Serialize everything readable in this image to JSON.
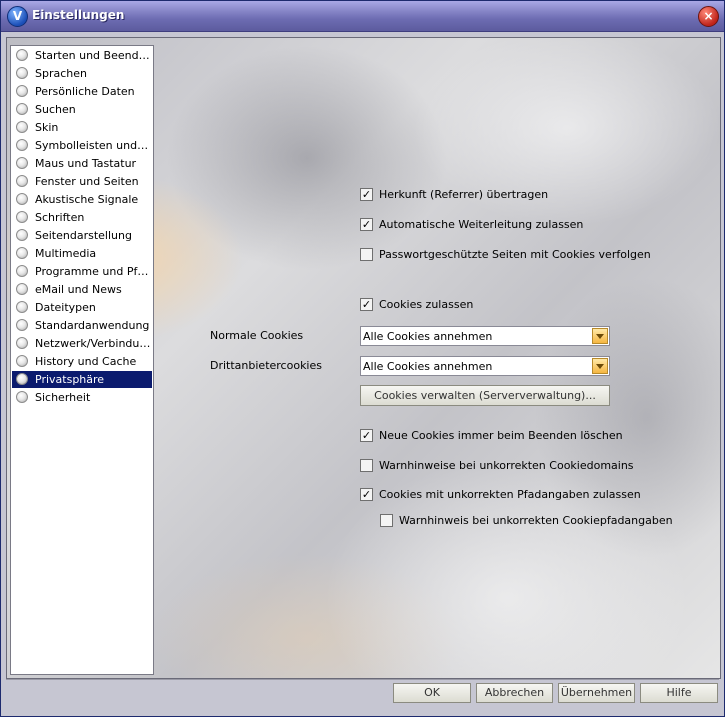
{
  "window": {
    "title": "Einstellungen",
    "icon": "app-logo-icon",
    "close": "close-icon"
  },
  "sidebar": {
    "items": [
      {
        "label": "Starten und Beenden"
      },
      {
        "label": "Sprachen"
      },
      {
        "label": "Persönliche Daten"
      },
      {
        "label": "Suchen"
      },
      {
        "label": "Skin"
      },
      {
        "label": "Symbolleisten und Me..."
      },
      {
        "label": "Maus und Tastatur"
      },
      {
        "label": "Fenster und Seiten"
      },
      {
        "label": "Akustische Signale"
      },
      {
        "label": "Schriften"
      },
      {
        "label": "Seitendarstellung"
      },
      {
        "label": "Multimedia"
      },
      {
        "label": "Programme und Pfade"
      },
      {
        "label": "eMail und News"
      },
      {
        "label": "Dateitypen"
      },
      {
        "label": "Standardanwendung"
      },
      {
        "label": "Netzwerk/Verbindungen"
      },
      {
        "label": "History und Cache"
      },
      {
        "label": "Privatsphäre",
        "selected": true
      },
      {
        "label": "Sicherheit"
      }
    ]
  },
  "privacy": {
    "referrer": {
      "label": "Herkunft (Referrer) übertragen",
      "checked": true
    },
    "redirect": {
      "label": "Automatische Weiterleitung zulassen",
      "checked": true
    },
    "password_cookies": {
      "label": "Passwortgeschützte Seiten mit Cookies verfolgen",
      "checked": false
    },
    "cookies_allow": {
      "label": "Cookies zulassen",
      "checked": true
    },
    "normal_cookies": {
      "label": "Normale Cookies",
      "value": "Alle Cookies annehmen"
    },
    "third_party_cookies": {
      "label": "Drittanbietercookies",
      "value": "Alle Cookies annehmen"
    },
    "manage_cookies_button": "Cookies verwalten (Serververwaltung)...",
    "delete_on_exit": {
      "label": "Neue Cookies immer beim Beenden löschen",
      "checked": true
    },
    "warn_domains": {
      "label": "Warnhinweise bei unkorrekten Cookiedomains",
      "checked": false
    },
    "allow_bad_paths": {
      "label": "Cookies mit unkorrekten Pfadangaben zulassen",
      "checked": true
    },
    "warn_paths": {
      "label": "Warnhinweis bei unkorrekten Cookiepfadangaben",
      "checked": false
    }
  },
  "footer": {
    "ok": "OK",
    "cancel": "Abbrechen",
    "apply": "Übernehmen",
    "help": "Hilfe"
  },
  "colors": {
    "title_bar": "#7a79bd",
    "selection": "#0b1b6e",
    "dropdown_arrow": "#f5b641"
  }
}
